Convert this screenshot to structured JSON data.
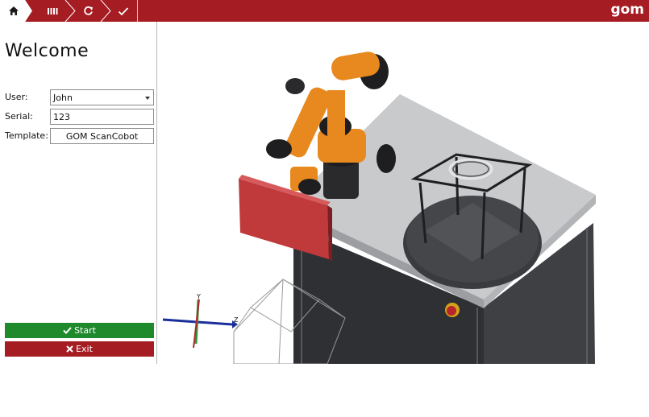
{
  "topbar": {
    "brand": "gom",
    "crumbs": [
      {
        "icon": "home-icon"
      },
      {
        "icon": "bars-icon"
      },
      {
        "icon": "refresh-icon"
      },
      {
        "icon": "check-icon"
      }
    ],
    "colors": {
      "bar": "#a51c22",
      "text": "#ffffff"
    }
  },
  "panel": {
    "title": "Welcome",
    "fields": {
      "user": {
        "label": "User:",
        "value": "John"
      },
      "serial": {
        "label": "Serial:",
        "value": "123"
      },
      "template": {
        "label": "Template:",
        "value": "GOM ScanCobot"
      }
    },
    "start_label": "Start",
    "exit_label": "Exit",
    "colors": {
      "start": "#1f8a2c",
      "exit": "#a51c22"
    }
  },
  "view": {
    "axis_labels": {
      "y": "Y",
      "z": "Z"
    },
    "colors": {
      "robot": "#e8891f",
      "table": "#3a3b3e",
      "scanner": "#c0393b",
      "axis_x": "#b22a2a",
      "axis_y": "#2e9a3a",
      "axis_z": "#1b2f9a"
    }
  }
}
